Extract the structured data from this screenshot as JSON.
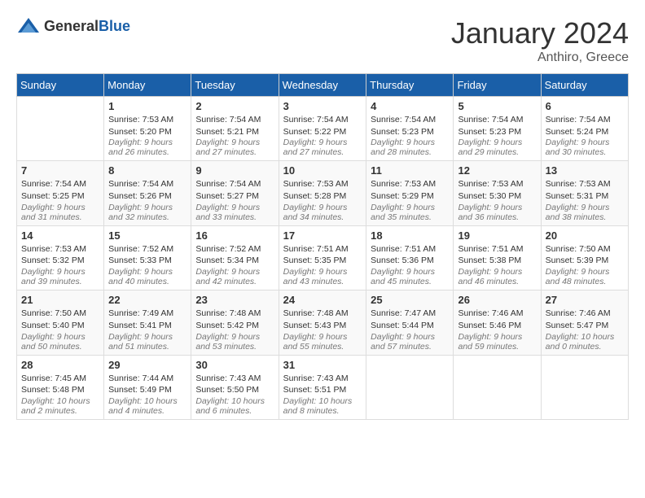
{
  "header": {
    "logo": {
      "general": "General",
      "blue": "Blue"
    },
    "month": "January 2024",
    "location": "Anthiro, Greece"
  },
  "days_of_week": [
    "Sunday",
    "Monday",
    "Tuesday",
    "Wednesday",
    "Thursday",
    "Friday",
    "Saturday"
  ],
  "weeks": [
    [
      {
        "day": "",
        "info": ""
      },
      {
        "day": "1",
        "info": "Sunrise: 7:53 AM\nSunset: 5:20 PM\nDaylight: 9 hours and 26 minutes."
      },
      {
        "day": "2",
        "info": "Sunrise: 7:54 AM\nSunset: 5:21 PM\nDaylight: 9 hours and 27 minutes."
      },
      {
        "day": "3",
        "info": "Sunrise: 7:54 AM\nSunset: 5:22 PM\nDaylight: 9 hours and 27 minutes."
      },
      {
        "day": "4",
        "info": "Sunrise: 7:54 AM\nSunset: 5:23 PM\nDaylight: 9 hours and 28 minutes."
      },
      {
        "day": "5",
        "info": "Sunrise: 7:54 AM\nSunset: 5:23 PM\nDaylight: 9 hours and 29 minutes."
      },
      {
        "day": "6",
        "info": "Sunrise: 7:54 AM\nSunset: 5:24 PM\nDaylight: 9 hours and 30 minutes."
      }
    ],
    [
      {
        "day": "7",
        "info": "Sunrise: 7:54 AM\nSunset: 5:25 PM\nDaylight: 9 hours and 31 minutes."
      },
      {
        "day": "8",
        "info": "Sunrise: 7:54 AM\nSunset: 5:26 PM\nDaylight: 9 hours and 32 minutes."
      },
      {
        "day": "9",
        "info": "Sunrise: 7:54 AM\nSunset: 5:27 PM\nDaylight: 9 hours and 33 minutes."
      },
      {
        "day": "10",
        "info": "Sunrise: 7:53 AM\nSunset: 5:28 PM\nDaylight: 9 hours and 34 minutes."
      },
      {
        "day": "11",
        "info": "Sunrise: 7:53 AM\nSunset: 5:29 PM\nDaylight: 9 hours and 35 minutes."
      },
      {
        "day": "12",
        "info": "Sunrise: 7:53 AM\nSunset: 5:30 PM\nDaylight: 9 hours and 36 minutes."
      },
      {
        "day": "13",
        "info": "Sunrise: 7:53 AM\nSunset: 5:31 PM\nDaylight: 9 hours and 38 minutes."
      }
    ],
    [
      {
        "day": "14",
        "info": "Sunrise: 7:53 AM\nSunset: 5:32 PM\nDaylight: 9 hours and 39 minutes."
      },
      {
        "day": "15",
        "info": "Sunrise: 7:52 AM\nSunset: 5:33 PM\nDaylight: 9 hours and 40 minutes."
      },
      {
        "day": "16",
        "info": "Sunrise: 7:52 AM\nSunset: 5:34 PM\nDaylight: 9 hours and 42 minutes."
      },
      {
        "day": "17",
        "info": "Sunrise: 7:51 AM\nSunset: 5:35 PM\nDaylight: 9 hours and 43 minutes."
      },
      {
        "day": "18",
        "info": "Sunrise: 7:51 AM\nSunset: 5:36 PM\nDaylight: 9 hours and 45 minutes."
      },
      {
        "day": "19",
        "info": "Sunrise: 7:51 AM\nSunset: 5:38 PM\nDaylight: 9 hours and 46 minutes."
      },
      {
        "day": "20",
        "info": "Sunrise: 7:50 AM\nSunset: 5:39 PM\nDaylight: 9 hours and 48 minutes."
      }
    ],
    [
      {
        "day": "21",
        "info": "Sunrise: 7:50 AM\nSunset: 5:40 PM\nDaylight: 9 hours and 50 minutes."
      },
      {
        "day": "22",
        "info": "Sunrise: 7:49 AM\nSunset: 5:41 PM\nDaylight: 9 hours and 51 minutes."
      },
      {
        "day": "23",
        "info": "Sunrise: 7:48 AM\nSunset: 5:42 PM\nDaylight: 9 hours and 53 minutes."
      },
      {
        "day": "24",
        "info": "Sunrise: 7:48 AM\nSunset: 5:43 PM\nDaylight: 9 hours and 55 minutes."
      },
      {
        "day": "25",
        "info": "Sunrise: 7:47 AM\nSunset: 5:44 PM\nDaylight: 9 hours and 57 minutes."
      },
      {
        "day": "26",
        "info": "Sunrise: 7:46 AM\nSunset: 5:46 PM\nDaylight: 9 hours and 59 minutes."
      },
      {
        "day": "27",
        "info": "Sunrise: 7:46 AM\nSunset: 5:47 PM\nDaylight: 10 hours and 0 minutes."
      }
    ],
    [
      {
        "day": "28",
        "info": "Sunrise: 7:45 AM\nSunset: 5:48 PM\nDaylight: 10 hours and 2 minutes."
      },
      {
        "day": "29",
        "info": "Sunrise: 7:44 AM\nSunset: 5:49 PM\nDaylight: 10 hours and 4 minutes."
      },
      {
        "day": "30",
        "info": "Sunrise: 7:43 AM\nSunset: 5:50 PM\nDaylight: 10 hours and 6 minutes."
      },
      {
        "day": "31",
        "info": "Sunrise: 7:43 AM\nSunset: 5:51 PM\nDaylight: 10 hours and 8 minutes."
      },
      {
        "day": "",
        "info": ""
      },
      {
        "day": "",
        "info": ""
      },
      {
        "day": "",
        "info": ""
      }
    ]
  ]
}
